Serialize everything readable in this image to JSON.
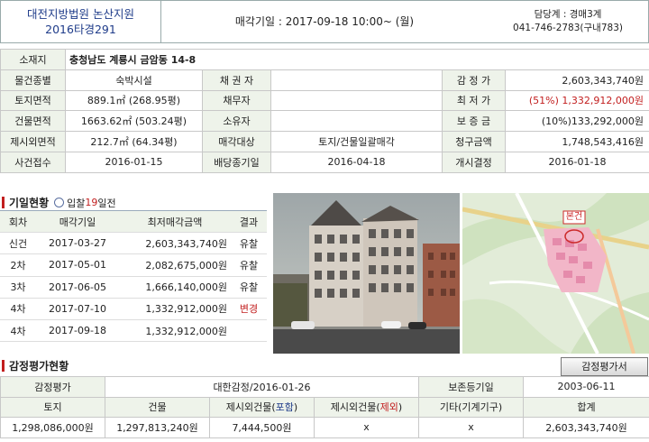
{
  "header": {
    "court": "대전지방법원 논산지원",
    "case_no": "2016타경291",
    "auction_date": "매각기일 : 2017-09-18   10:00~ (월)",
    "dept": "담당계 : 경매3계",
    "phone": "041-746-2783(구내783)"
  },
  "info": {
    "location_label": "소재지",
    "location": "충청남도 계룡시 금암동 14-8",
    "type_label": "물건종별",
    "type": "숙박시설",
    "creditor_label": "채 권 자",
    "creditor": "",
    "appraisal_label": "감 정 가",
    "appraisal": "2,603,343,740원",
    "land_label": "토지면적",
    "land": "889.1㎡ (268.95평)",
    "debtor_label": "채무자",
    "debtor": "",
    "min_price_label": "최 저 가",
    "min_price_pct": "(51%)",
    "min_price": "1,332,912,000원",
    "bldg_label": "건물면적",
    "bldg": "1663.62㎡ (503.24평)",
    "owner_label": "소유자",
    "owner": "",
    "deposit_label": "보 증 금",
    "deposit": "(10%)133,292,000원",
    "excl_label": "제시외면적",
    "excl": "212.7㎡ (64.34평)",
    "sale_target_label": "매각대상",
    "sale_target": "토지/건물일괄매각",
    "claim_label": "청구금액",
    "claim": "1,748,543,416원",
    "received_label": "사건접수",
    "received": "2016-01-15",
    "dividend_label": "배당종기일",
    "dividend": "2016-04-18",
    "start_label": "개시결정",
    "start": "2016-01-18"
  },
  "history": {
    "title": "기일현황",
    "sub_prefix": "입찰",
    "sub_days": "19",
    "sub_suffix": "일전",
    "headers": [
      "회차",
      "매각기일",
      "최저매각금액",
      "결과"
    ],
    "rows": [
      {
        "round": "신건",
        "date": "2017-03-27",
        "price": "2,603,343,740원",
        "result": "유찰"
      },
      {
        "round": "2차",
        "date": "2017-05-01",
        "price": "2,082,675,000원",
        "result": "유찰"
      },
      {
        "round": "3차",
        "date": "2017-06-05",
        "price": "1,666,140,000원",
        "result": "유찰"
      },
      {
        "round": "4차",
        "date": "2017-07-10",
        "price": "1,332,912,000원",
        "result": "변경"
      },
      {
        "round": "4차",
        "date": "2017-09-18",
        "price": "1,332,912,000원",
        "result": ""
      }
    ]
  },
  "map": {
    "marker": "본건"
  },
  "appraisal": {
    "title": "감정평가현황",
    "button": "감정평가서",
    "label": "감정평가",
    "firm": "대한감정/2016-01-26",
    "preserve_label": "보존등기일",
    "preserve": "2003-06-11",
    "cols": [
      "토지",
      "건물",
      "제시외건물(포함)",
      "제시외건물(제외)",
      "기타(기계기구)",
      "합계"
    ],
    "col3_pre": "제시외건물(",
    "col3_mid": "포함",
    "col4_mid": "제외",
    "col_suffix": ")",
    "values": [
      "1,298,086,000원",
      "1,297,813,240원",
      "7,444,500원",
      "x",
      "x",
      "2,603,343,740원"
    ]
  }
}
